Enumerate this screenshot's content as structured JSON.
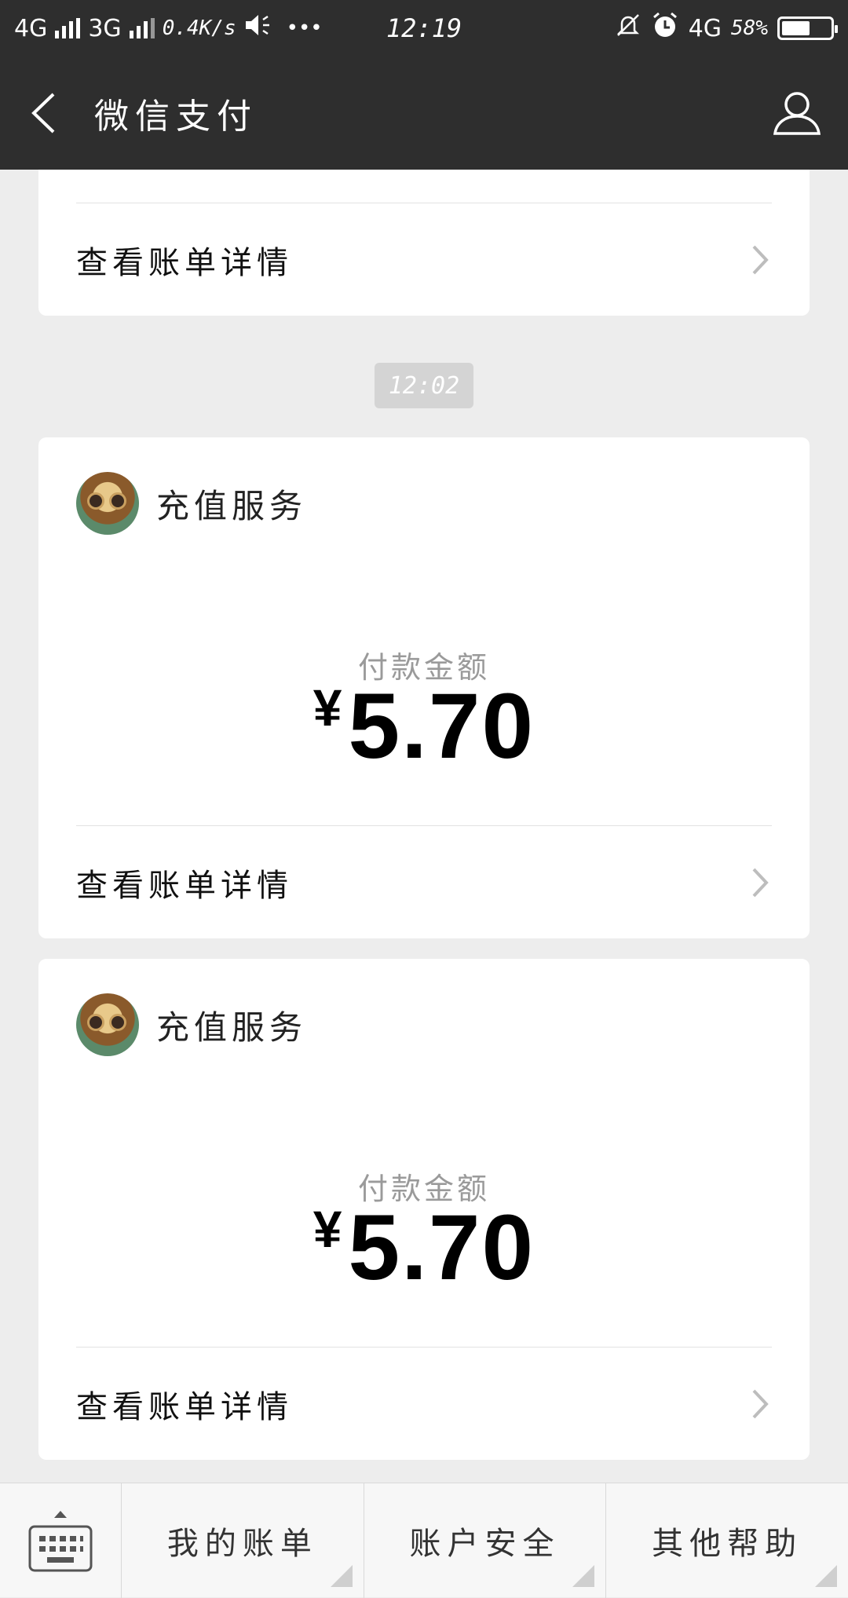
{
  "status_bar": {
    "network1": "4G",
    "network2": "3G",
    "speed": "0.4K/s",
    "dots": "•••",
    "time": "12:19",
    "network3": "4G",
    "battery": "58%"
  },
  "nav": {
    "title": "微信支付"
  },
  "messages": [
    {
      "detail_label": "查看账单详情"
    }
  ],
  "time_separator": "12:02",
  "payments": [
    {
      "merchant": "充值服务",
      "amount_label": "付款金额",
      "currency": "¥",
      "amount": "5.70",
      "detail_label": "查看账单详情"
    },
    {
      "merchant": "充值服务",
      "amount_label": "付款金额",
      "currency": "¥",
      "amount": "5.70",
      "detail_label": "查看账单详情"
    }
  ],
  "bottom_menu": {
    "items": [
      {
        "label": "我的账单"
      },
      {
        "label": "账户安全"
      },
      {
        "label": "其他帮助"
      }
    ]
  },
  "colors": {
    "header_bg": "#2e2e2e",
    "page_bg": "#ededed",
    "card_bg": "#ffffff",
    "muted_text": "#9a9a9a"
  }
}
